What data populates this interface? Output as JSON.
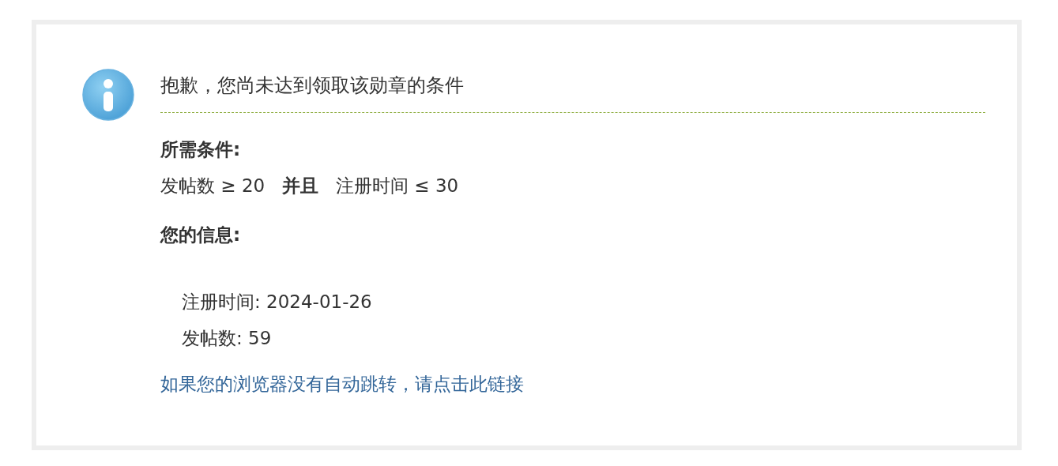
{
  "message": {
    "title": "抱歉，您尚未达到领取该勋章的条件",
    "requirements_label": "所需条件:",
    "requirements": "发帖数 ≥ 20   **并且**   注册时间 ≤ 30",
    "info_label": "您的信息:",
    "info": [
      "注册时间: 2024-01-26",
      "发帖数: 59"
    ],
    "link": "如果您的浏览器没有自动跳转，请点击此链接"
  }
}
